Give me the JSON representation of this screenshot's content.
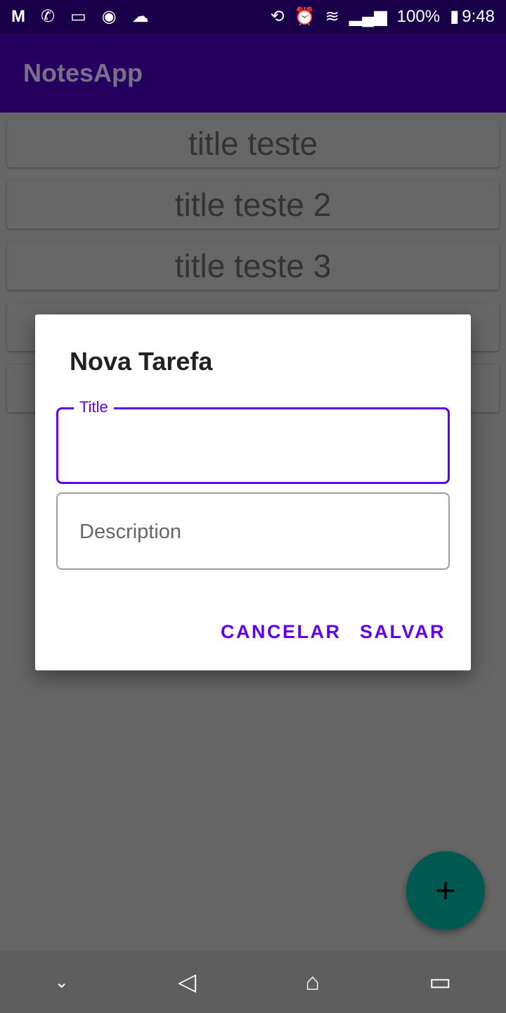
{
  "status_bar": {
    "battery": "100%",
    "time": "9:48",
    "icons": [
      "gmail-icon",
      "whatsapp-icon",
      "gallery-icon",
      "record-icon",
      "cloud-icon",
      "rotate-icon",
      "alarm-icon",
      "wifi-icon",
      "signal-icon",
      "battery-icon"
    ]
  },
  "app_bar": {
    "title": "NotesApp"
  },
  "notes": [
    {
      "title": "title teste"
    },
    {
      "title": "title teste 2"
    },
    {
      "title": "title teste 3"
    },
    {
      "title": ""
    },
    {
      "title": ""
    }
  ],
  "dialog": {
    "title": "Nova Tarefa",
    "title_field": {
      "label": "Title",
      "value": ""
    },
    "description_field": {
      "placeholder": "Description",
      "value": ""
    },
    "cancel_label": "CANCELAR",
    "save_label": "SALVAR"
  },
  "fab": {
    "icon": "plus-icon",
    "symbol": "+"
  },
  "nav_bar": {
    "icons": [
      "hide-nav-icon",
      "back-icon",
      "home-icon",
      "recents-icon"
    ]
  },
  "colors": {
    "accent": "#6200ee",
    "primary": "#25005f",
    "fab": "#005a52"
  }
}
